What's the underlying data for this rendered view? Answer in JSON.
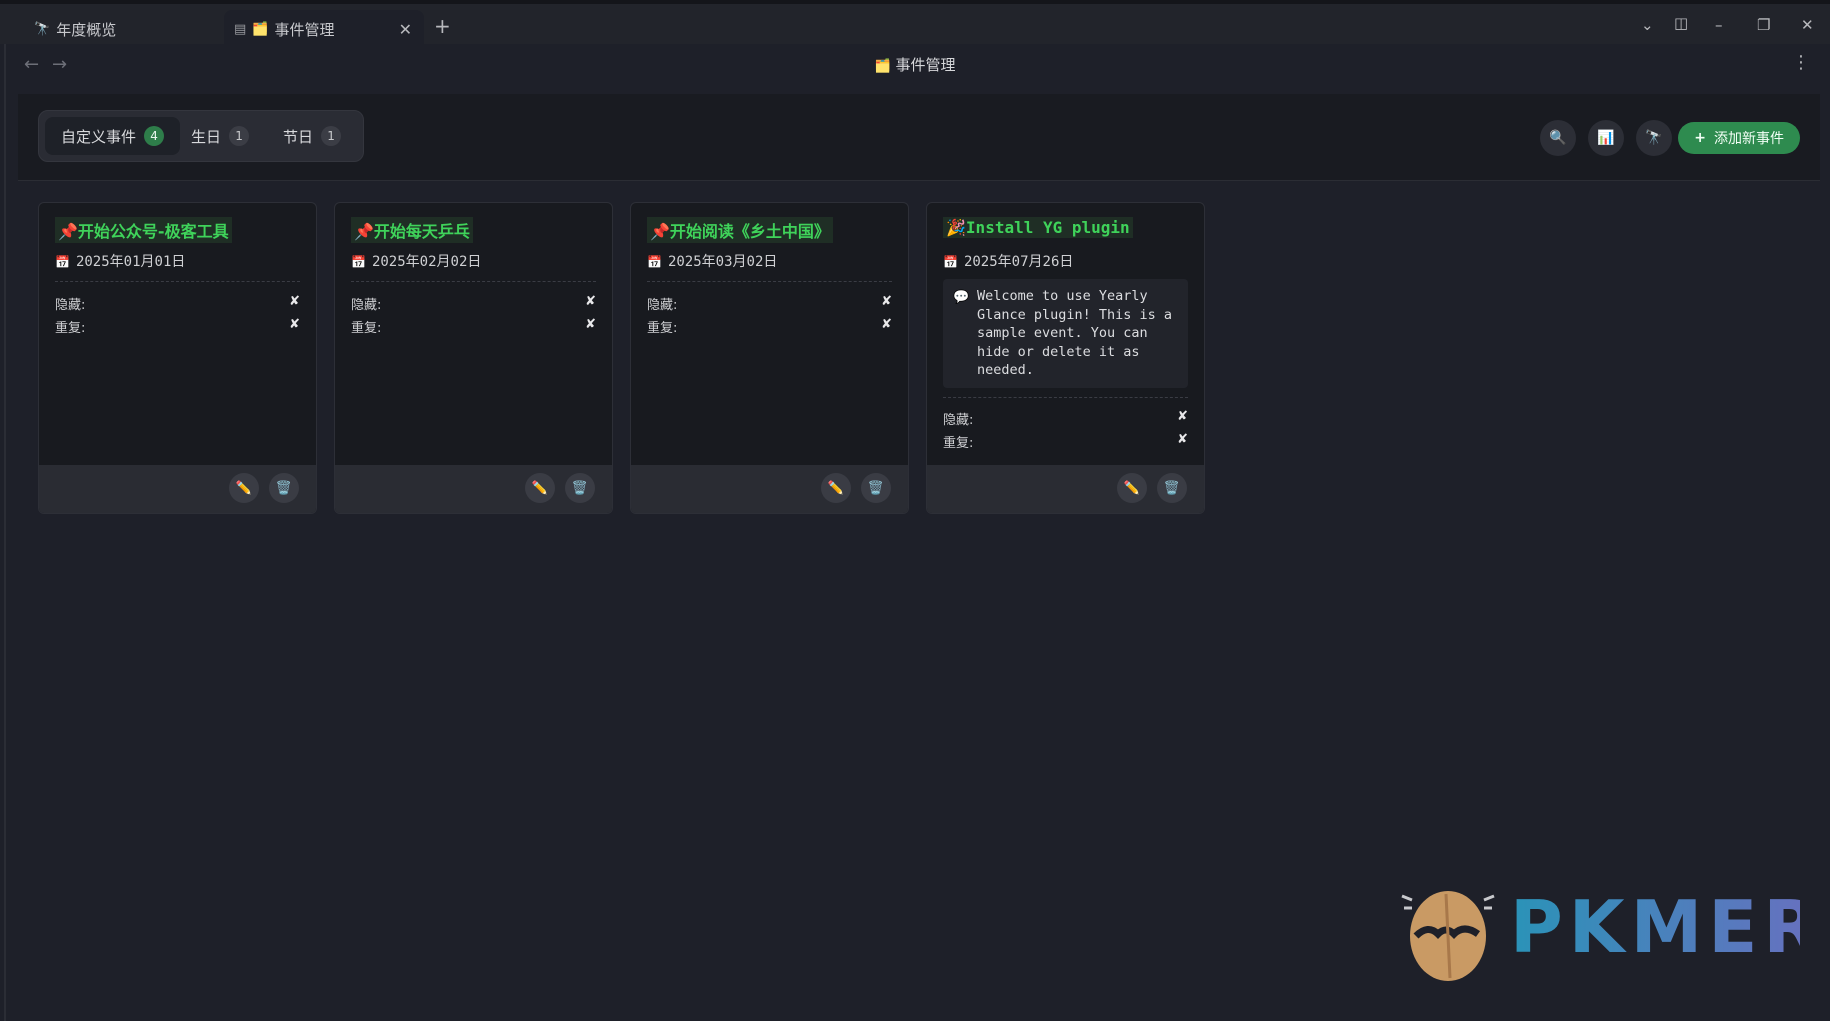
{
  "tabs": [
    {
      "label": "年度概览",
      "icon": "telescope-icon",
      "active": false
    },
    {
      "label": "事件管理",
      "icon": "folder-icon",
      "active": true
    }
  ],
  "page_title": "事件管理",
  "categories": [
    {
      "label": "自定义事件",
      "count": "4",
      "active": true
    },
    {
      "label": "生日",
      "count": "1",
      "active": false
    },
    {
      "label": "节日",
      "count": "1",
      "active": false
    }
  ],
  "toolbar": {
    "search_icon": "magnifier-icon",
    "chart_icon": "bar-chart-icon",
    "overview_icon": "telescope-icon",
    "add_label": "添加新事件",
    "add_prefix": "+"
  },
  "events": [
    {
      "title": "📌开始公众号-极客工具",
      "date": "2025年01月01日",
      "hidden_label": "隐藏:",
      "hidden_value": "✘",
      "repeat_label": "重复:",
      "repeat_value": "✘"
    },
    {
      "title": "📌开始每天乒乓",
      "date": "2025年02月02日",
      "hidden_label": "隐藏:",
      "hidden_value": "✘",
      "repeat_label": "重复:",
      "repeat_value": "✘"
    },
    {
      "title": "📌开始阅读《乡土中国》",
      "date": "2025年03月02日",
      "hidden_label": "隐藏:",
      "hidden_value": "✘",
      "repeat_label": "重复:",
      "repeat_value": "✘"
    },
    {
      "title": "🎉Install YG plugin",
      "date": "2025年07月26日",
      "description": "Welcome to use Yearly Glance plugin! This is a sample event. You can hide or delete it as needed.",
      "hidden_label": "隐藏:",
      "hidden_value": "✘",
      "repeat_label": "重复:",
      "repeat_value": "✘"
    }
  ],
  "watermark": {
    "text": "PKMER"
  },
  "colors": {
    "accent_green": "#2e8b4f",
    "title_green": "#3fd35a",
    "background": "#1e2029"
  }
}
